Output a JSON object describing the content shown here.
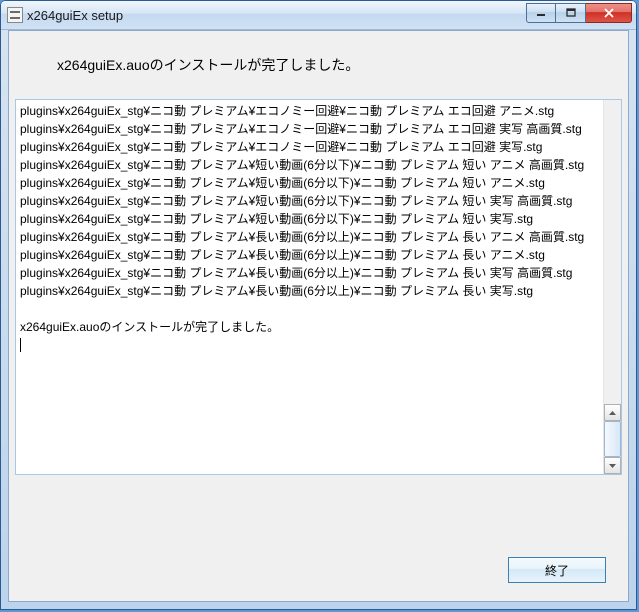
{
  "window": {
    "title": "x264guiEx setup"
  },
  "heading": "x264guiEx.auoのインストールが完了しました。",
  "log_lines": [
    "plugins¥x264guiEx_stg¥ニコ動 プレミアム¥エコノミー回避¥ニコ動 プレミアム エコ回避 アニメ.stg",
    "plugins¥x264guiEx_stg¥ニコ動 プレミアム¥エコノミー回避¥ニコ動 プレミアム エコ回避 実写 高画質.stg",
    "plugins¥x264guiEx_stg¥ニコ動 プレミアム¥エコノミー回避¥ニコ動 プレミアム エコ回避 実写.stg",
    "plugins¥x264guiEx_stg¥ニコ動 プレミアム¥短い動画(6分以下)¥ニコ動 プレミアム 短い アニメ 高画質.stg",
    "plugins¥x264guiEx_stg¥ニコ動 プレミアム¥短い動画(6分以下)¥ニコ動 プレミアム 短い アニメ.stg",
    "plugins¥x264guiEx_stg¥ニコ動 プレミアム¥短い動画(6分以下)¥ニコ動 プレミアム 短い 実写 高画質.stg",
    "plugins¥x264guiEx_stg¥ニコ動 プレミアム¥短い動画(6分以下)¥ニコ動 プレミアム 短い 実写.stg",
    "plugins¥x264guiEx_stg¥ニコ動 プレミアム¥長い動画(6分以上)¥ニコ動 プレミアム 長い アニメ 高画質.stg",
    "plugins¥x264guiEx_stg¥ニコ動 プレミアム¥長い動画(6分以上)¥ニコ動 プレミアム 長い アニメ.stg",
    "plugins¥x264guiEx_stg¥ニコ動 プレミアム¥長い動画(6分以上)¥ニコ動 プレミアム 長い 実写 高画質.stg",
    "plugins¥x264guiEx_stg¥ニコ動 プレミアム¥長い動画(6分以上)¥ニコ動 プレミアム 長い 実写.stg",
    "",
    "x264guiEx.auoのインストールが完了しました。"
  ],
  "buttons": {
    "finish": "終了"
  }
}
